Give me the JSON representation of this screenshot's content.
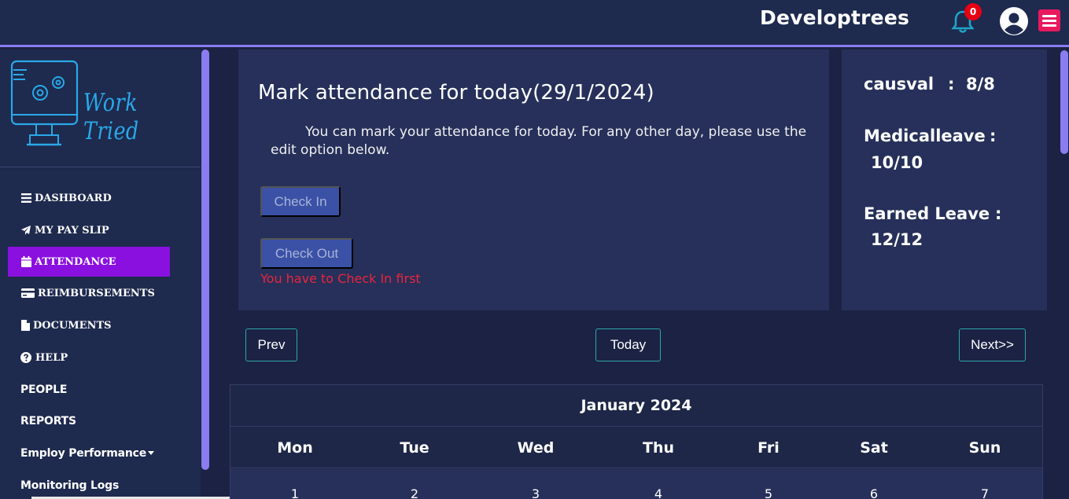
{
  "header": {
    "brand": "Developtrees",
    "notification_count": "0",
    "icons": [
      "bell-icon",
      "user-avatar-icon",
      "hamburger-menu-icon"
    ],
    "menu_color": "#e8195e"
  },
  "sidebar": {
    "logo_text": "Work Tried",
    "items": [
      {
        "label": "DASHBOARD",
        "icon": "bars-icon"
      },
      {
        "label": "MY PAY SLIP",
        "icon": "paper-plane-icon"
      },
      {
        "label": "ATTENDANCE",
        "icon": "calendar-icon",
        "active": true
      },
      {
        "label": "REIMBURSEMENTS",
        "icon": "credit-card-icon"
      },
      {
        "label": "DOCUMENTS",
        "icon": "file-icon"
      },
      {
        "label": "HELP",
        "icon": "question-circle-icon"
      },
      {
        "label": "PEOPLE"
      },
      {
        "label": "REPORTS"
      },
      {
        "label": "Employ Performance"
      },
      {
        "label": "Monitoring Logs"
      }
    ],
    "active_color": "#8a10e0"
  },
  "attendance": {
    "title": "Mark attendance for today(29/1/2024)",
    "description": "You can mark your attendance for today. For any other day, please use the edit option below.",
    "check_in_label": "Check In",
    "check_out_label": "Check Out",
    "warning": "You have to Check In first"
  },
  "leaves": {
    "causal_label": "causval",
    "causal_sep": ":",
    "causal_value": "8/8",
    "medical_label": "Medicalleave",
    "medical_sep": ":",
    "medical_value": "10/10",
    "earned_label": "Earned Leave",
    "earned_sep": ":",
    "earned_value": "12/12"
  },
  "calendar": {
    "prev_label": "Prev",
    "today_label": "Today",
    "next_label": "Next>>",
    "month_title": "January 2024",
    "weekdays": [
      "Mon",
      "Tue",
      "Wed",
      "Thu",
      "Fri",
      "Sat",
      "Sun"
    ],
    "first_week": [
      "1",
      "2",
      "3",
      "4",
      "5",
      "6",
      "7"
    ]
  }
}
